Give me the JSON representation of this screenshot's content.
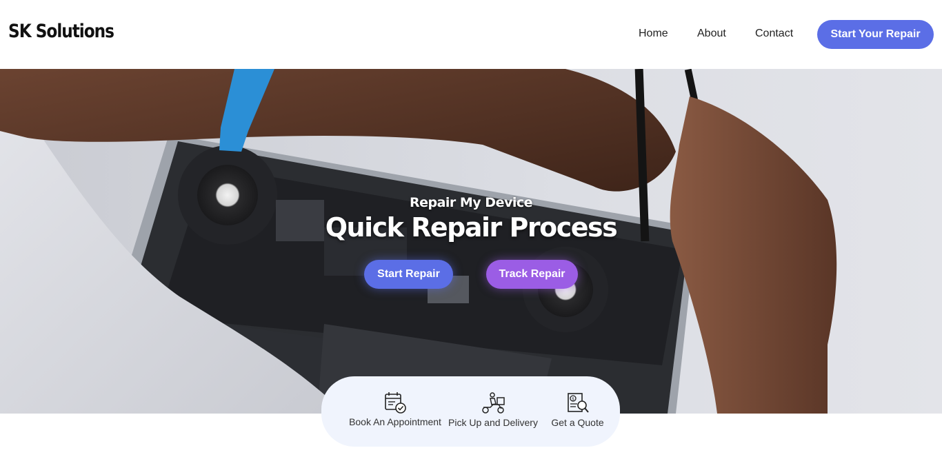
{
  "header": {
    "logo": "SK Solutions",
    "nav": [
      "Home",
      "About",
      "Contact"
    ],
    "cta": "Start Your Repair"
  },
  "hero": {
    "subtitle": "Repair My Device",
    "title": "Quick Repair Process",
    "start_button": "Start Repair",
    "track_button": "Track Repair",
    "background_image": "laptop-repair-photo"
  },
  "services": [
    {
      "label": "Book An Appointment",
      "icon": "calendar-check-icon"
    },
    {
      "label": "Pick Up and Delivery",
      "icon": "delivery-scooter-icon"
    },
    {
      "label": "Get a Quote",
      "icon": "quote-document-icon"
    }
  ],
  "colors": {
    "primary": "#5b6ee6",
    "secondary": "#9b5de5",
    "services_bg": "#f0f4fd"
  }
}
